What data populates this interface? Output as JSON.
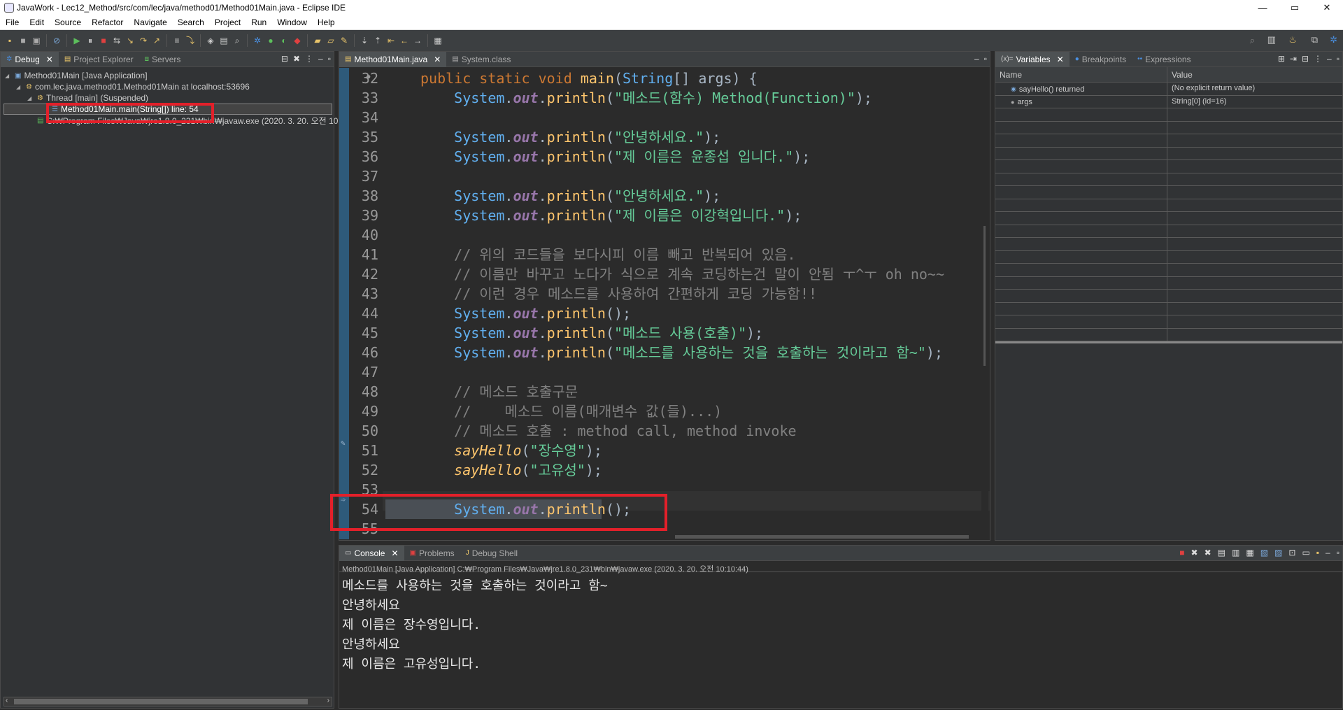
{
  "window": {
    "title": "JavaWork - Lec12_Method/src/com/lec/java/method01/Method01Main.java - Eclipse IDE",
    "min": "—",
    "max": "▭",
    "close": "✕"
  },
  "menu": [
    "File",
    "Edit",
    "Source",
    "Refactor",
    "Navigate",
    "Search",
    "Project",
    "Run",
    "Window",
    "Help"
  ],
  "debug_panel": {
    "tabs": [
      {
        "label": "Debug",
        "icon": "debug-icon"
      },
      {
        "label": "Project Explorer",
        "icon": "project-explorer-icon"
      },
      {
        "label": "Servers",
        "icon": "servers-icon"
      }
    ],
    "tree": [
      {
        "label": "Method01Main [Java Application]",
        "icon": "java-app-icon"
      },
      {
        "label": "com.lec.java.method01.Method01Main at localhost:53696",
        "icon": "launch-icon"
      },
      {
        "label": "Thread [main] (Suspended)",
        "icon": "thread-icon"
      },
      {
        "label": "Method01Main.main(String[]) line: 54",
        "icon": "stack-frame-icon"
      },
      {
        "label": "C:₩Program Files₩Java₩jre1.8.0_231₩bin₩javaw.exe (2020. 3. 20. 오전 10:1",
        "icon": "process-icon"
      }
    ]
  },
  "editor": {
    "tabs": [
      {
        "label": "Method01Main.java",
        "icon": "java-file-icon"
      },
      {
        "label": "System.class",
        "icon": "class-file-icon"
      }
    ],
    "lines": [
      {
        "n": "32",
        "segs": [
          [
            "kw",
            "public static void "
          ],
          [
            "fn",
            "main"
          ],
          [
            "pl",
            "("
          ],
          [
            "cls",
            "String"
          ],
          [
            "pl",
            "[] "
          ],
          [
            "pl",
            "args) {"
          ]
        ]
      },
      {
        "n": "33",
        "segs": [
          [
            "pl",
            "    "
          ],
          [
            "cls",
            "System"
          ],
          [
            "pl",
            "."
          ],
          [
            "fld",
            "out"
          ],
          [
            "pl",
            "."
          ],
          [
            "fn",
            "println"
          ],
          [
            "pl",
            "("
          ],
          [
            "st",
            "\"메소드(함수) Method(Function)\""
          ],
          [
            "pl",
            ");"
          ]
        ]
      },
      {
        "n": "34",
        "segs": []
      },
      {
        "n": "35",
        "segs": [
          [
            "pl",
            "    "
          ],
          [
            "cls",
            "System"
          ],
          [
            "pl",
            "."
          ],
          [
            "fld",
            "out"
          ],
          [
            "pl",
            "."
          ],
          [
            "fn",
            "println"
          ],
          [
            "pl",
            "("
          ],
          [
            "st",
            "\"안녕하세요.\""
          ],
          [
            "pl",
            ");"
          ]
        ]
      },
      {
        "n": "36",
        "segs": [
          [
            "pl",
            "    "
          ],
          [
            "cls",
            "System"
          ],
          [
            "pl",
            "."
          ],
          [
            "fld",
            "out"
          ],
          [
            "pl",
            "."
          ],
          [
            "fn",
            "println"
          ],
          [
            "pl",
            "("
          ],
          [
            "st",
            "\"제 이름은 윤종섭 입니다.\""
          ],
          [
            "pl",
            ");"
          ]
        ]
      },
      {
        "n": "37",
        "segs": []
      },
      {
        "n": "38",
        "segs": [
          [
            "pl",
            "    "
          ],
          [
            "cls",
            "System"
          ],
          [
            "pl",
            "."
          ],
          [
            "fld",
            "out"
          ],
          [
            "pl",
            "."
          ],
          [
            "fn",
            "println"
          ],
          [
            "pl",
            "("
          ],
          [
            "st",
            "\"안녕하세요.\""
          ],
          [
            "pl",
            ");"
          ]
        ]
      },
      {
        "n": "39",
        "segs": [
          [
            "pl",
            "    "
          ],
          [
            "cls",
            "System"
          ],
          [
            "pl",
            "."
          ],
          [
            "fld",
            "out"
          ],
          [
            "pl",
            "."
          ],
          [
            "fn",
            "println"
          ],
          [
            "pl",
            "("
          ],
          [
            "st",
            "\"제 이름은 이강혁입니다.\""
          ],
          [
            "pl",
            ");"
          ]
        ]
      },
      {
        "n": "40",
        "segs": []
      },
      {
        "n": "41",
        "segs": [
          [
            "pl",
            "    "
          ],
          [
            "cm",
            "// 위의 코드들을 보다시피 이름 빼고 반복되어 있음."
          ]
        ]
      },
      {
        "n": "42",
        "segs": [
          [
            "pl",
            "    "
          ],
          [
            "cm",
            "// 이름만 바꾸고 노다가 식으로 계속 코딩하는건 말이 안됨 ㅜ^ㅜ oh no~~"
          ]
        ]
      },
      {
        "n": "43",
        "segs": [
          [
            "pl",
            "    "
          ],
          [
            "cm",
            "// 이런 경우 메소드를 사용하여 간편하게 코딩 가능함!!"
          ]
        ]
      },
      {
        "n": "44",
        "segs": [
          [
            "pl",
            "    "
          ],
          [
            "cls",
            "System"
          ],
          [
            "pl",
            "."
          ],
          [
            "fld",
            "out"
          ],
          [
            "pl",
            "."
          ],
          [
            "fn",
            "println"
          ],
          [
            "pl",
            "();"
          ]
        ]
      },
      {
        "n": "45",
        "segs": [
          [
            "pl",
            "    "
          ],
          [
            "cls",
            "System"
          ],
          [
            "pl",
            "."
          ],
          [
            "fld",
            "out"
          ],
          [
            "pl",
            "."
          ],
          [
            "fn",
            "println"
          ],
          [
            "pl",
            "("
          ],
          [
            "st",
            "\"메소드 사용(호출)\""
          ],
          [
            "pl",
            ");"
          ]
        ]
      },
      {
        "n": "46",
        "segs": [
          [
            "pl",
            "    "
          ],
          [
            "cls",
            "System"
          ],
          [
            "pl",
            "."
          ],
          [
            "fld",
            "out"
          ],
          [
            "pl",
            "."
          ],
          [
            "fn",
            "println"
          ],
          [
            "pl",
            "("
          ],
          [
            "st",
            "\"메소드를 사용하는 것을 호출하는 것이라고 함~\""
          ],
          [
            "pl",
            ");"
          ]
        ]
      },
      {
        "n": "47",
        "segs": []
      },
      {
        "n": "48",
        "segs": [
          [
            "pl",
            "    "
          ],
          [
            "cm",
            "// 메소드 호출구문"
          ]
        ]
      },
      {
        "n": "49",
        "segs": [
          [
            "pl",
            "    "
          ],
          [
            "cm",
            "//    메소드 이름(매개변수 값(들)...)"
          ]
        ]
      },
      {
        "n": "50",
        "segs": [
          [
            "pl",
            "    "
          ],
          [
            "cm",
            "// 메소드 호출 : method call, method invoke"
          ]
        ]
      },
      {
        "n": "51",
        "segs": [
          [
            "pl",
            "    "
          ],
          [
            "it",
            "sayHello"
          ],
          [
            "pl",
            "("
          ],
          [
            "st",
            "\"장수영\""
          ],
          [
            "pl",
            ");"
          ]
        ]
      },
      {
        "n": "52",
        "segs": [
          [
            "pl",
            "    "
          ],
          [
            "it",
            "sayHello"
          ],
          [
            "pl",
            "("
          ],
          [
            "st",
            "\"고유성\""
          ],
          [
            "pl",
            ");"
          ]
        ]
      },
      {
        "n": "53",
        "segs": []
      },
      {
        "n": "54",
        "segs": [
          [
            "pl",
            "    "
          ],
          [
            "cls",
            "System"
          ],
          [
            "pl",
            "."
          ],
          [
            "fld",
            "out"
          ],
          [
            "pl",
            "."
          ],
          [
            "fn",
            "println"
          ],
          [
            "pl",
            "();"
          ]
        ]
      },
      {
        "n": "55",
        "segs": []
      }
    ]
  },
  "variables_panel": {
    "tabs": [
      {
        "label": "Variables",
        "icon": "variables-icon"
      },
      {
        "label": "Breakpoints",
        "icon": "breakpoints-icon"
      },
      {
        "label": "Expressions",
        "icon": "expressions-icon"
      }
    ],
    "col_name": "Name",
    "col_value": "Value",
    "rows": [
      {
        "name": "sayHello() returned",
        "value": "(No explicit return value)"
      },
      {
        "name": "args",
        "value": "String[0]  (id=16)"
      }
    ]
  },
  "console_panel": {
    "tabs": [
      {
        "label": "Console",
        "icon": "console-icon"
      },
      {
        "label": "Problems",
        "icon": "problems-icon"
      },
      {
        "label": "Debug Shell",
        "icon": "debug-shell-icon"
      }
    ],
    "process": "Method01Main [Java Application] C:₩Program Files₩Java₩jre1.8.0_231₩bin₩javaw.exe (2020. 3. 20. 오전 10:10:44)",
    "output": [
      "메소드를 사용하는 것을 호출하는 것이라고 함~",
      "안녕하세요",
      "제 이름은 장수영입니다.",
      "안녕하세요",
      "제 이름은 고유성입니다."
    ]
  }
}
